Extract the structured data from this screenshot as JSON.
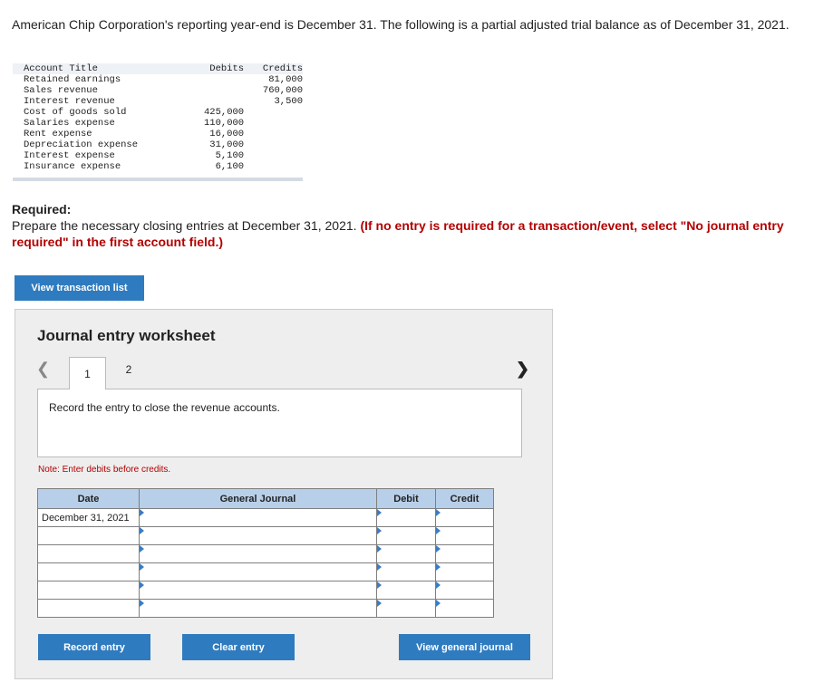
{
  "intro": "American Chip Corporation's reporting year-end is December 31. The following is a partial adjusted trial balance as of December 31, 2021.",
  "trial_balance": {
    "headers": {
      "account": "Account Title",
      "debits": "Debits",
      "credits": "Credits"
    },
    "rows": [
      {
        "account": "Retained earnings",
        "debit": "",
        "credit": "81,000"
      },
      {
        "account": "Sales revenue",
        "debit": "",
        "credit": "760,000"
      },
      {
        "account": "Interest revenue",
        "debit": "",
        "credit": "3,500"
      },
      {
        "account": "Cost of goods sold",
        "debit": "425,000",
        "credit": ""
      },
      {
        "account": "Salaries expense",
        "debit": "110,000",
        "credit": ""
      },
      {
        "account": "Rent expense",
        "debit": "16,000",
        "credit": ""
      },
      {
        "account": "Depreciation expense",
        "debit": "31,000",
        "credit": ""
      },
      {
        "account": "Interest expense",
        "debit": "5,100",
        "credit": ""
      },
      {
        "account": "Insurance expense",
        "debit": "6,100",
        "credit": ""
      }
    ]
  },
  "required": {
    "heading": "Required:",
    "text": "Prepare the necessary closing entries at December 31, 2021.",
    "instruction": "(If no entry is required for a transaction/event, select \"No journal entry required\" in the first account field.)"
  },
  "buttons": {
    "view_transactions": "View transaction list",
    "record": "Record entry",
    "clear": "Clear entry",
    "view_journal": "View general journal"
  },
  "worksheet": {
    "title": "Journal entry worksheet",
    "tabs": [
      "1",
      "2"
    ],
    "prev_icon": "chevron-left-icon",
    "next_icon": "chevron-right-icon",
    "prompt": "Record the entry to close the revenue accounts.",
    "note": "Note: Enter debits before credits.",
    "columns": {
      "date": "Date",
      "journal": "General Journal",
      "debit": "Debit",
      "credit": "Credit"
    },
    "rows": [
      {
        "date": "December 31, 2021"
      },
      {
        "date": ""
      },
      {
        "date": ""
      },
      {
        "date": ""
      },
      {
        "date": ""
      },
      {
        "date": ""
      }
    ]
  },
  "colors": {
    "accent": "#2f7bbf",
    "header_bg": "#b8cfe9",
    "alert": "#b30000",
    "panel_bg": "#eeeeee"
  }
}
